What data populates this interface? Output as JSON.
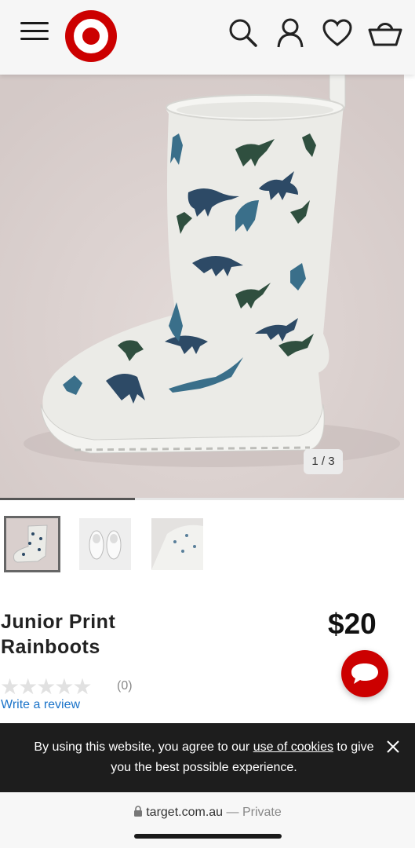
{
  "header": {
    "icons": [
      "menu-icon",
      "target-logo",
      "search-icon",
      "account-icon",
      "heart-icon",
      "basket-icon"
    ]
  },
  "gallery": {
    "counter": "1 / 3",
    "current_index": 1,
    "total": 3,
    "progress_fraction": 0.3333
  },
  "product": {
    "title": "Junior Print Rainboots",
    "price": "$20",
    "rating_count": "(0)",
    "write_review": "Write a review",
    "rating_stars_filled": 0,
    "rating_stars_total": 5
  },
  "cookie_banner": {
    "text_before": "By using this website, you agree to our ",
    "link_text": "use of cookies",
    "text_after": " to give you the best possible experience."
  },
  "browser": {
    "domain": "target.com.au",
    "separator": " — ",
    "mode": "Private"
  },
  "colors": {
    "brand_red": "#cc0000",
    "link_blue": "#1a73c9",
    "banner_bg": "#1d1d1d"
  }
}
